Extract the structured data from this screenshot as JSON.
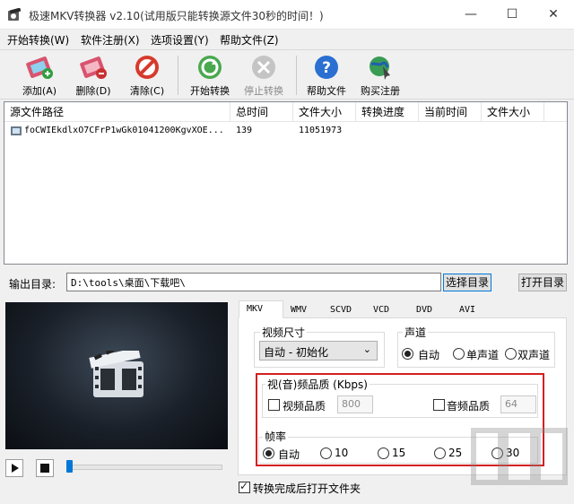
{
  "window": {
    "title": "极速MKV转换器 v2.10(试用版只能转换源文件30秒的时间！)",
    "minimize_glyph": "—",
    "maximize_glyph": "☐",
    "close_glyph": "✕"
  },
  "menu": {
    "items": [
      "开始转换(W)",
      "软件注册(X)",
      "选项设置(Y)",
      "帮助文件(Z)"
    ]
  },
  "toolbar": {
    "add": "添加(A)",
    "delete": "删除(D)",
    "clear": "清除(C)",
    "start": "开始转换",
    "stop": "停止转换",
    "help": "帮助文件",
    "buy": "购买注册"
  },
  "file_list": {
    "columns": [
      "源文件路径",
      "总时间",
      "文件大小",
      "转换进度",
      "当前时间",
      "文件大小"
    ],
    "rows": [
      {
        "path": "foCWIEkdlxO7CFrP1wGk01041200KgvXOE...",
        "duration": "139",
        "size": "11051973",
        "progress": "",
        "current_time": "",
        "out_size": ""
      }
    ]
  },
  "output": {
    "label": "输出目录:",
    "path": "D:\\tools\\桌面\\下载吧\\",
    "choose_button": "选择目录",
    "open_button": "打开目录"
  },
  "tabs": [
    "MKV",
    "WMV",
    "SCVD",
    "VCD",
    "DVD",
    "AVI"
  ],
  "settings": {
    "video_size_label": "视频尺寸",
    "video_size_value": "自动 - 初始化",
    "channel_label": "声道",
    "channel_options": [
      "自动",
      "单声道",
      "双声道"
    ],
    "quality_label": "视(音)频品质 (Kbps)",
    "video_quality_label": "视频品质",
    "video_quality_value": "800",
    "audio_quality_label": "音频品质",
    "audio_quality_value": "64",
    "framerate_label": "帧率",
    "framerate_options": [
      "自动",
      "10",
      "15",
      "25",
      "30"
    ],
    "open_after_label": "转换完成后打开文件夹"
  },
  "colors": {
    "accent": "#0078d7",
    "highlight_box": "#d42020"
  }
}
